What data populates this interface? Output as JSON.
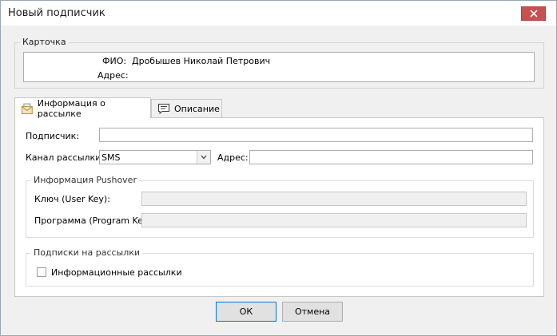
{
  "window": {
    "title": "Новый подписчик"
  },
  "card": {
    "legend": "Карточка",
    "fio_label": "ФИО:",
    "fio_value": "Дробышев Николай Петрович",
    "address_label": "Адрес:",
    "address_value": ""
  },
  "tabs": [
    {
      "label": "Информация о рассылке",
      "icon": "mail-icon",
      "active": true
    },
    {
      "label": "Описание",
      "icon": "comment-icon",
      "active": false
    }
  ],
  "form": {
    "subscriber_label": "Подписчик:",
    "subscriber_value": "",
    "channel_label": "Канал рассылки:",
    "channel_value": "SMS",
    "address_label": "Адрес:",
    "address_value": ""
  },
  "pushover": {
    "legend": "Информация Pushover",
    "user_key_label": "Ключ (User Key):",
    "user_key_value": "",
    "program_key_label": "Программа (Program Key):",
    "program_key_value": ""
  },
  "subscriptions": {
    "legend": "Подписки на рассылки",
    "items": [
      {
        "label": "Информационные рассылки",
        "checked": false
      }
    ]
  },
  "buttons": {
    "ok": "ОК",
    "cancel": "Отмена"
  },
  "colors": {
    "close_button": "#c75050",
    "primary_border": "#0078d7"
  }
}
